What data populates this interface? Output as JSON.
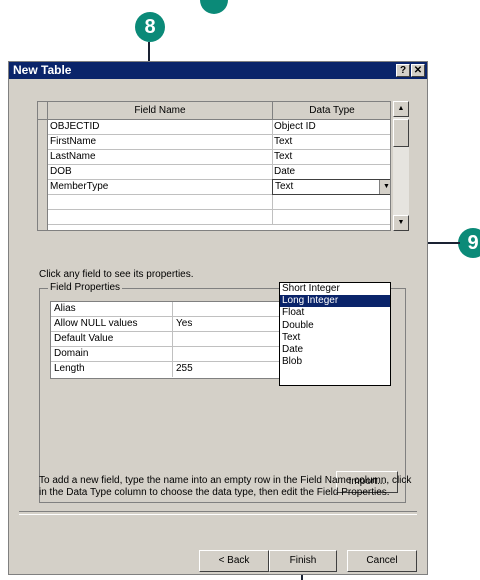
{
  "callouts": {
    "step8": "8",
    "step9": "9"
  },
  "dialog": {
    "title": "New Table",
    "help_btn": "?",
    "close_btn": "✕"
  },
  "grid": {
    "col_field_name": "Field Name",
    "col_data_type": "Data Type",
    "rows": [
      {
        "field": "OBJECTID",
        "type": "Object ID"
      },
      {
        "field": "FirstName",
        "type": "Text"
      },
      {
        "field": "LastName",
        "type": "Text"
      },
      {
        "field": "DOB",
        "type": "Date"
      },
      {
        "field": "MemberType",
        "type": "Text"
      }
    ]
  },
  "dropdown": {
    "options": [
      "Short Integer",
      "Long Integer",
      "Float",
      "Double",
      "Text",
      "Date",
      "Blob"
    ],
    "highlighted": "Long Integer"
  },
  "hint": "Click any field to see its properties.",
  "field_properties": {
    "title": "Field Properties",
    "rows": [
      {
        "name": "Alias",
        "value": ""
      },
      {
        "name": "Allow NULL values",
        "value": "Yes"
      },
      {
        "name": "Default Value",
        "value": ""
      },
      {
        "name": "Domain",
        "value": ""
      },
      {
        "name": "Length",
        "value": "255"
      }
    ]
  },
  "import_btn": "Import...",
  "description": "To add a new field, type the name into an empty row in the Field Name column, click in the Data Type column to choose the data type, then edit the Field Properties.",
  "buttons": {
    "back": "< Back",
    "finish": "Finish",
    "cancel": "Cancel"
  },
  "colors": {
    "callout": "#0b8a78",
    "titlebar": "#0a246a",
    "dialog_bg": "#d4d0c8"
  }
}
